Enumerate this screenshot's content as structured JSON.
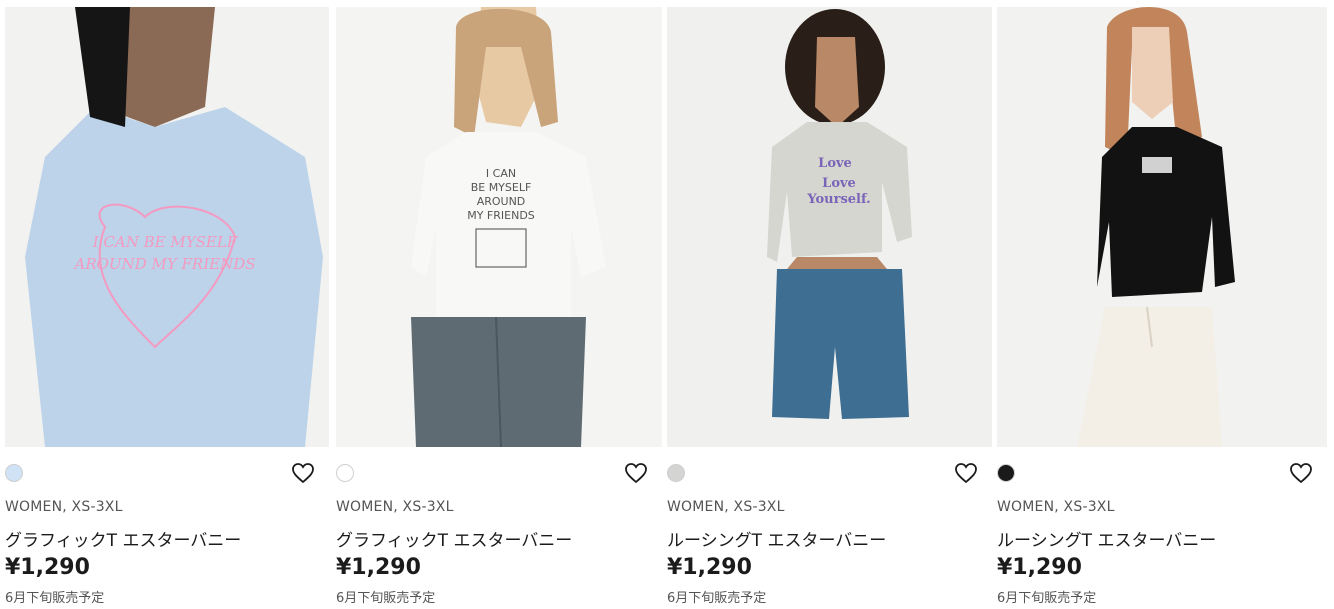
{
  "products": [
    {
      "meta": "WOMEN, XS-3XL",
      "name": "グラフィックT エスターバニー",
      "price": "¥1,290",
      "note": "6月下旬販売予定",
      "swatch_color": "#cfe2f6",
      "shirt_print": [
        "I CAN BE MYSELF",
        "AROUND MY FRIENDS"
      ]
    },
    {
      "meta": "WOMEN, XS-3XL",
      "name": "グラフィックT エスターバニー",
      "price": "¥1,290",
      "note": "6月下旬販売予定",
      "swatch_color": "#ffffff",
      "shirt_print": [
        "I CAN",
        "BE MYSELF",
        "AROUND",
        "MY FRIENDS"
      ]
    },
    {
      "meta": "WOMEN, XS-3XL",
      "name": "ルーシングT エスターバニー",
      "price": "¥1,290",
      "note": "6月下旬販売予定",
      "swatch_color": "#d4d4d2",
      "shirt_print": [
        "Love",
        "Love",
        "Yourself."
      ]
    },
    {
      "meta": "WOMEN, XS-3XL",
      "name": "ルーシングT エスターバニー",
      "price": "¥1,290",
      "note": "6月下旬販売予定",
      "swatch_color": "#1a1a1a"
    }
  ]
}
